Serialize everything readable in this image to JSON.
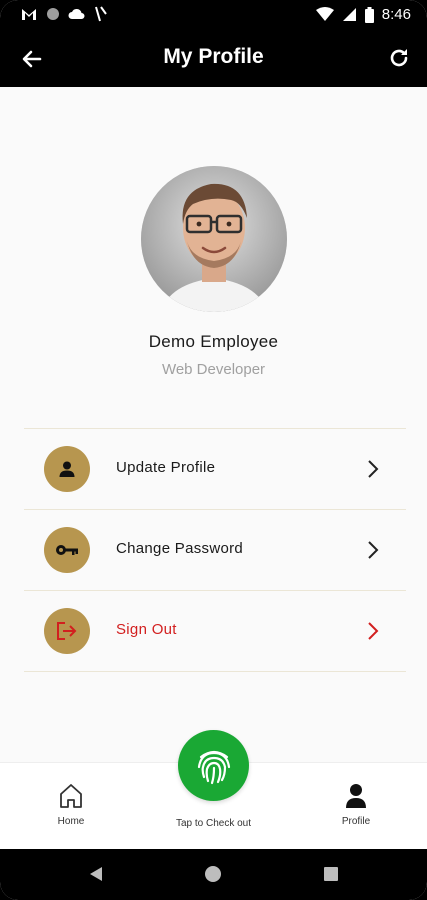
{
  "status_bar": {
    "time": "8:46",
    "icons": [
      "gmail-icon",
      "circle-notification-icon",
      "cloud-icon",
      "signal-slash-icon",
      "wifi-icon",
      "cellular-icon",
      "battery-icon"
    ]
  },
  "app_bar": {
    "title": "My Profile",
    "back_icon": "arrow-left-icon",
    "refresh_icon": "refresh-icon"
  },
  "profile": {
    "name": "Demo Employee",
    "role": "Web Developer"
  },
  "menu": {
    "items": [
      {
        "label": "Update Profile",
        "icon": "person-icon"
      },
      {
        "label": "Change Password",
        "icon": "key-icon"
      },
      {
        "label": "Sign Out",
        "icon": "sign-out-icon"
      }
    ]
  },
  "bottom_nav": {
    "home_label": "Home",
    "checkout_label": "Tap to Check out",
    "profile_label": "Profile"
  },
  "colors": {
    "accent": "#b7964f",
    "danger": "#d21f1f",
    "checkout_green": "#1aa834",
    "header_bg": "#000000",
    "page_bg": "#fafafa"
  }
}
